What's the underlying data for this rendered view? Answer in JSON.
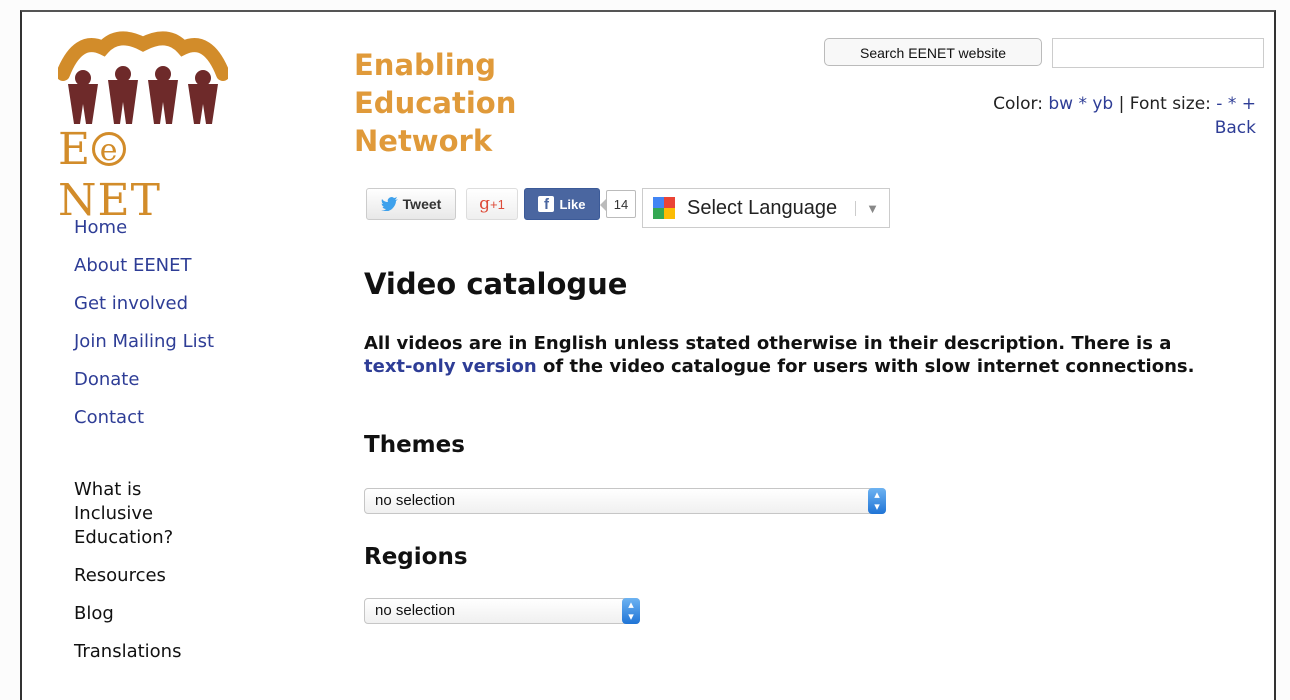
{
  "brand": {
    "logo_text_pre": "E",
    "logo_text_circle": "e",
    "logo_text_post": "NET",
    "title_line1": "Enabling",
    "title_line2": "Education",
    "title_line3": "Network",
    "colors": {
      "logo": "#d28c2a",
      "figures": "#6e2a2a",
      "title": "#e09a3a",
      "link": "#2e3d96"
    }
  },
  "search": {
    "button_label": "Search EENET website",
    "input_value": ""
  },
  "prefs": {
    "color_label": "Color:",
    "bw": "bw",
    "sep": "*",
    "yb": "yb",
    "pipe": "|",
    "font_label": "Font size:",
    "minus": "-",
    "star": "*",
    "plus": "+",
    "back": "Back"
  },
  "social": {
    "tweet": "Tweet",
    "gplus": "+1",
    "like": "Like",
    "like_count": "14",
    "translate": "Select Language"
  },
  "nav": {
    "primary": [
      "Home",
      "About EENET",
      "Get involved",
      "Join Mailing List",
      "Donate",
      "Contact"
    ],
    "secondary": [
      "What is Inclusive Education?",
      "Resources",
      "Blog",
      "Translations"
    ]
  },
  "main": {
    "title": "Video catalogue",
    "intro_1": "All videos are in English unless stated otherwise in their description. There is a ",
    "intro_link": "text-only version",
    "intro_2": " of the video catalogue for users with slow internet connections.",
    "themes_heading": "Themes",
    "themes_value": "no selection",
    "regions_heading": "Regions",
    "regions_value": "no selection"
  }
}
